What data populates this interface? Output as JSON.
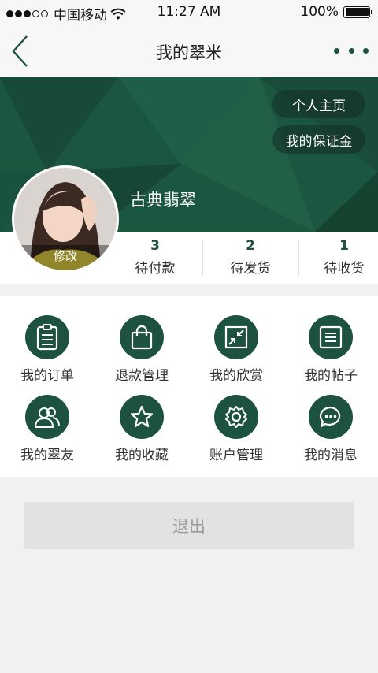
{
  "status_bar": {
    "carrier": "中国移动",
    "time": "11:27 AM",
    "battery": "100%"
  },
  "nav": {
    "title": "我的翠米"
  },
  "hero": {
    "homepage_label": "个人主页",
    "deposit_label": "我的保证金",
    "username": "古典翡翠",
    "edit_label": "修改"
  },
  "stats": [
    {
      "count": "3",
      "label": "待付款"
    },
    {
      "count": "2",
      "label": "待发货"
    },
    {
      "count": "1",
      "label": "待收货"
    }
  ],
  "menu": [
    {
      "label": "我的订单",
      "icon": "clipboard-icon"
    },
    {
      "label": "退款管理",
      "icon": "shopping-bag-icon"
    },
    {
      "label": "我的欣赏",
      "icon": "shrink-arrows-icon"
    },
    {
      "label": "我的帖子",
      "icon": "document-lines-icon"
    },
    {
      "label": "我的翠友",
      "icon": "friends-icon"
    },
    {
      "label": "我的收藏",
      "icon": "star-icon"
    },
    {
      "label": "账户管理",
      "icon": "gear-icon"
    },
    {
      "label": "我的消息",
      "icon": "chat-bubble-icon"
    }
  ],
  "logout_label": "退出",
  "colors": {
    "brand_green": "#1d5240",
    "hero_green": "#1b5641"
  }
}
